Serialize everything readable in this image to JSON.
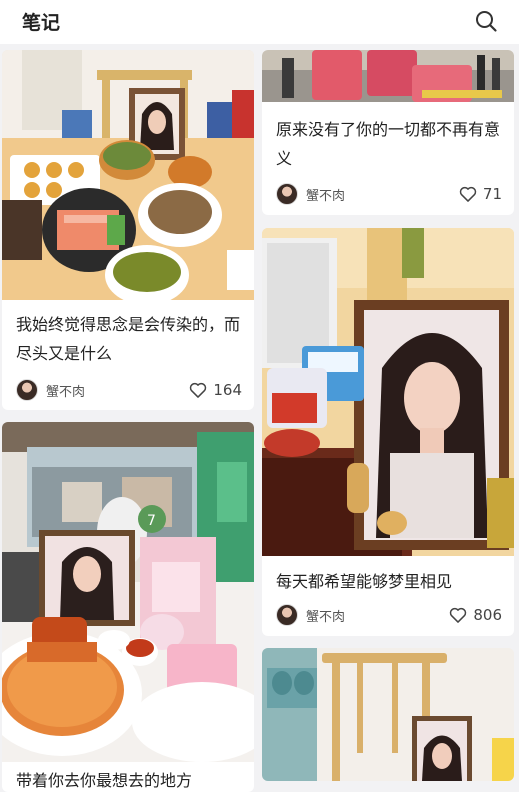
{
  "header": {
    "title": "笔记"
  },
  "icons": {
    "search": "search-icon",
    "heart": "heart-icon"
  },
  "colors": {
    "background": "#f2f2f4",
    "card": "#ffffff",
    "text": "#222222",
    "muted": "#555555"
  },
  "feed": {
    "left": [
      {
        "image": "photo-restaurant-table-with-framed-portrait",
        "text": "我始终觉得思念是会传染的，而尽头又是什么",
        "author": "蟹不肉",
        "likes": "164"
      },
      {
        "image": "photo-cafe-table-with-framed-portrait-and-gift-bag",
        "text": "带着你去你最想去的地方"
      }
    ],
    "right": [
      {
        "image": "photo-street-traffic",
        "text": "原来没有了你的一切都不再有意义",
        "author": "蟹不肉",
        "likes": "71"
      },
      {
        "image": "photo-framed-portrait-with-snacks",
        "text": "每天都希望能够梦里相见",
        "author": "蟹不肉",
        "likes": "806"
      },
      {
        "image": "photo-room-with-chair-and-framed-portrait"
      }
    ]
  }
}
